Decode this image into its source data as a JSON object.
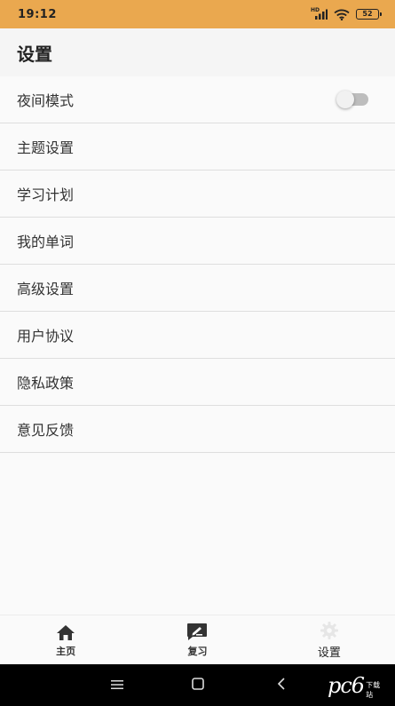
{
  "status_bar": {
    "time": "19:12",
    "network_label": "HD",
    "battery": "52",
    "bg_color": "#eaa84f"
  },
  "header": {
    "title": "设置"
  },
  "settings": {
    "items": [
      {
        "label": "夜间模式",
        "toggle": "off"
      },
      {
        "label": "主题设置"
      },
      {
        "label": "学习计划"
      },
      {
        "label": "我的单词"
      },
      {
        "label": "高级设置"
      },
      {
        "label": "用户协议"
      },
      {
        "label": "隐私政策"
      },
      {
        "label": "意见反馈"
      }
    ]
  },
  "bottom_nav": {
    "items": [
      {
        "label": "主页",
        "icon": "home-icon"
      },
      {
        "label": "复习",
        "icon": "review-icon"
      },
      {
        "label": "设置",
        "icon": "gear-icon",
        "active": true
      }
    ]
  },
  "watermark": {
    "brand": "pc6",
    "subtitle": "下载站"
  }
}
